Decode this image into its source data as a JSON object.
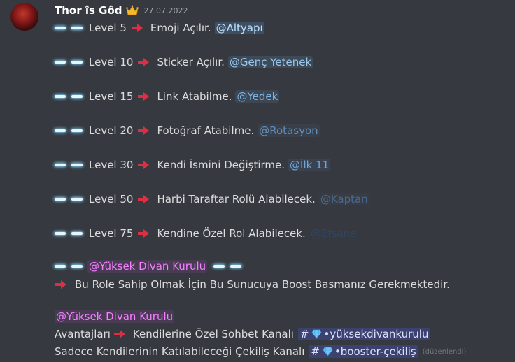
{
  "message": {
    "username": "Thor îs Gôd",
    "timestamp": "27.07.2022",
    "edited_label": "(düzenlendi)"
  },
  "levels": [
    {
      "level": "Level 5",
      "desc": "Emoji Açılır.",
      "role": "@Altyapı",
      "role_color": "#bfe1ff",
      "role_bg": "#3f4f63"
    },
    {
      "level": "Level 10",
      "desc": "Sticker Açılır.",
      "role": "@Genç Yetenek",
      "role_color": "#9cc7ee",
      "role_bg": "#3d4a58"
    },
    {
      "level": "Level 15",
      "desc": "Link Atabilme.",
      "role": "@Yedek",
      "role_color": "#7bb5e6",
      "role_bg": "#3c4753"
    },
    {
      "level": "Level 20",
      "desc": "Fotoğraf Atabilme.",
      "role": "@Rotasyon",
      "role_color": "#5e8fbf",
      "role_bg": "#394049"
    },
    {
      "level": "Level 30",
      "desc": "Kendi İsmini Değiştirme.",
      "role": "@İlk 11",
      "role_color": "#6fa7dc",
      "role_bg": "#39424e"
    },
    {
      "level": "Level 50",
      "desc": "Harbi Taraftar Rolü Alabilecek.",
      "role": "@Kaptan",
      "role_color": "#496a8f",
      "role_bg": "#383c44"
    },
    {
      "level": "Level 75",
      "desc": "Kendine Özel Rol Alabilecek.",
      "role": "@Efsane",
      "role_color": "#2d4566",
      "role_bg": "#363940"
    }
  ],
  "divan": {
    "role": "@Yüksek Divan Kurulu",
    "role_color": "#f47fff",
    "role_bg": "#4a3b55",
    "boost_text": "Bu Role Sahip Olmak İçin Bu Sunucuya Boost Basmanız Gerekmektedir.",
    "mention": "@Yüksek Divan Kurulu",
    "advantages_label": "Avantajları",
    "advantage1_text": "Kendilerine Özel Sohbet Kanalı",
    "advantage1_channel": "•yüksekdivankurulu",
    "advantage2_text": "Sadece Kendilerinin Katılabileceği Çekiliş Kanalı",
    "advantage2_channel": "•booster-çekiliş"
  }
}
